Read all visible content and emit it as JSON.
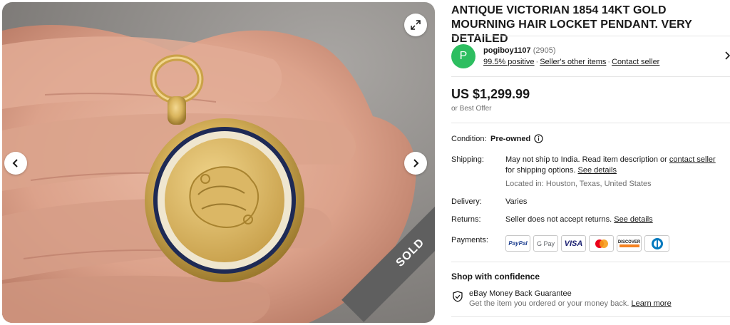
{
  "listing": {
    "title": "ANTIQUE VICTORIAN 1854 14KT GOLD MOURNING HAIR LOCKET PENDANT. VERY DETAILED",
    "sold_badge": "SOLD"
  },
  "seller": {
    "avatar_letter": "P",
    "avatar_color": "#2dbe60",
    "name": "pogiboy1107",
    "feedback_count": "(2905)",
    "positive": "99.5% positive",
    "other_items": "Seller's other items",
    "contact": "Contact seller"
  },
  "price": {
    "amount": "US $1,299.99",
    "best_offer": "or Best Offer"
  },
  "condition": {
    "label": "Condition:",
    "value": "Pre-owned"
  },
  "shipping": {
    "label": "Shipping:",
    "text_1": "May not ship to India. Read item description or ",
    "contact_link": "contact seller",
    "text_2": " for shipping options. ",
    "details_link": "See details",
    "location": "Located in: Houston, Texas, United States"
  },
  "delivery": {
    "label": "Delivery:",
    "value": "Varies"
  },
  "returns": {
    "label": "Returns:",
    "text": "Seller does not accept returns. ",
    "details_link": "See details"
  },
  "payments": {
    "label": "Payments:",
    "methods": [
      "PayPal",
      "G Pay",
      "VISA",
      "Mastercard",
      "DISCOVER",
      "Diners Club"
    ]
  },
  "confidence": {
    "heading": "Shop with confidence",
    "guarantee_title": "eBay Money Back Guarantee",
    "guarantee_text": "Get the item you ordered or your money back. ",
    "learn_more": "Learn more"
  },
  "icons": {
    "expand": "expand-icon",
    "prev": "chevron-left-icon",
    "next": "chevron-right-icon",
    "info": "info-icon",
    "shield": "shield-icon",
    "seller_more": "chevron-right-icon"
  }
}
